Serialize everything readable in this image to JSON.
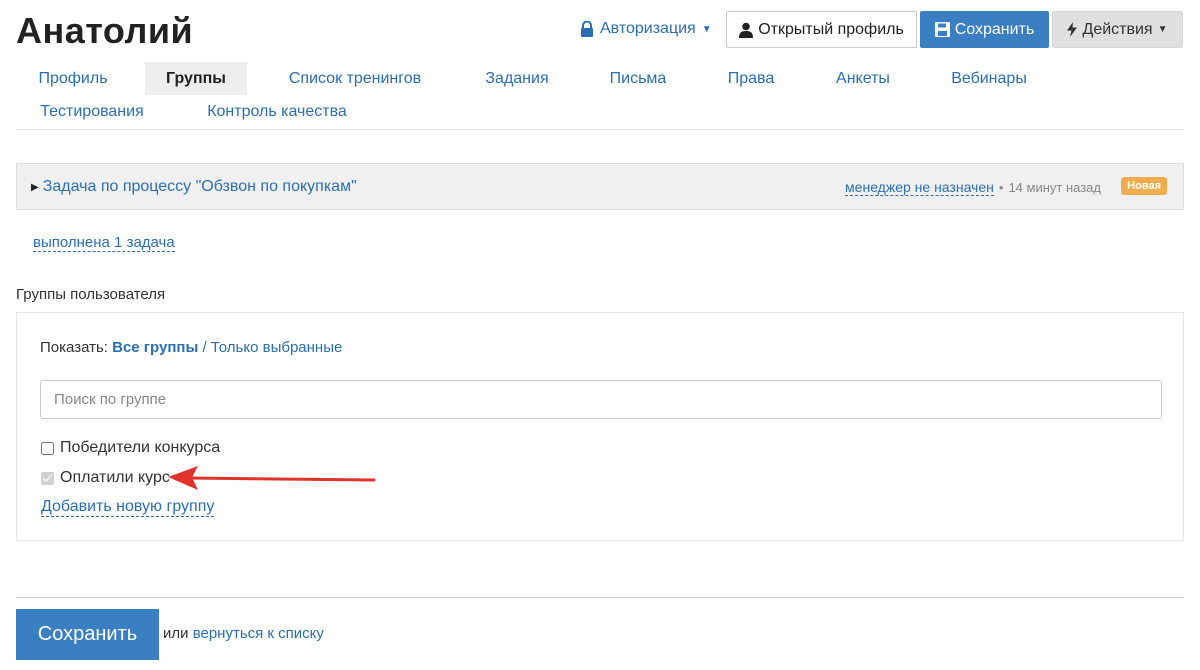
{
  "page": {
    "title": "Анатолий"
  },
  "toolbar": {
    "auth_label": "Авторизация",
    "open_profile_label": "Открытый профиль",
    "save_label": "Сохранить",
    "actions_label": "Действия"
  },
  "tabs": [
    {
      "label": "Профиль",
      "active": false
    },
    {
      "label": "Группы",
      "active": true
    },
    {
      "label": "Список тренингов",
      "active": false
    },
    {
      "label": "Задания",
      "active": false
    },
    {
      "label": "Письма",
      "active": false
    },
    {
      "label": "Права",
      "active": false
    },
    {
      "label": "Анкеты",
      "active": false
    },
    {
      "label": "Вебинары",
      "active": false
    },
    {
      "label": "Тестирования",
      "active": false
    },
    {
      "label": "Контроль качества",
      "active": false
    }
  ],
  "task": {
    "title": "Задача по процессу \"Обзвон по покупкам\"",
    "manager": "менеджер не назначен",
    "separator": "•",
    "time": "14 минут назад",
    "badge": "Новая"
  },
  "done_link": "выполнена 1 задача",
  "groups_section": {
    "label": "Группы пользователя",
    "show_prefix": "Показать:",
    "show_all": "Все группы",
    "show_sep": "/",
    "show_selected": "Только выбранные",
    "search_placeholder": "Поиск по группе",
    "items": [
      {
        "label": "Победители конкурса",
        "checked": false,
        "disabled": false
      },
      {
        "label": "Оплатили курс",
        "checked": true,
        "disabled": true
      }
    ],
    "add_group": "Добавить новую группу"
  },
  "footer": {
    "save_label": "Сохранить",
    "or_text": "или",
    "back_link": "вернуться к списку"
  },
  "colors": {
    "link": "#2a6fb3",
    "primary": "#3a7fc1",
    "badge": "#f0ad4e",
    "arrow": "#e0342b"
  },
  "icons": {
    "auth": "lock-icon",
    "profile": "user-icon",
    "save": "floppy-icon",
    "actions": "lightning-icon",
    "task_toggle": "triangle-right-icon",
    "annotation": "arrow-icon"
  }
}
